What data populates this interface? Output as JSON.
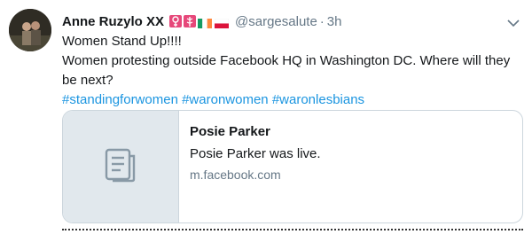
{
  "tweet": {
    "author_name": "Anne Ruzylo XX",
    "handle": "@sargesalute",
    "separator": "·",
    "time": "3h",
    "text_line1": "Women Stand Up!!!!",
    "text_line2": "Women protesting outside Facebook HQ in Washington DC. Where will they be next?",
    "hashtags": [
      "#standingforwomen",
      "#waronwomen",
      "#waronlesbians"
    ],
    "badges": [
      "female-sign-icon",
      "medical-caduceus-icon",
      "ireland-flag-icon",
      "poland-flag-icon"
    ],
    "menu_icon": "chevron-down-icon"
  },
  "card": {
    "title": "Posie Parker",
    "description": "Posie Parker was live.",
    "domain": "m.facebook.com",
    "media_icon": "document-icon"
  },
  "colors": {
    "link": "#1b95e0",
    "secondary_text": "#657786",
    "badge_pink": "#e6487a",
    "ireland_green": "#169b62",
    "ireland_orange": "#ff883e",
    "poland_red": "#dc143c"
  }
}
